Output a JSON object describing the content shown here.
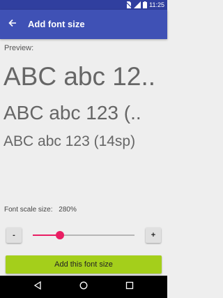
{
  "status_bar": {
    "time": "11:25"
  },
  "app_bar": {
    "title": "Add font size",
    "back_icon": "arrow-back-icon"
  },
  "preview": {
    "label": "Preview:",
    "samples": [
      {
        "text": "ABC abc 12.."
      },
      {
        "text": "ABC abc 123 (.."
      },
      {
        "text": "ABC abc 123 (14sp)"
      }
    ]
  },
  "font_scale": {
    "label": "Font scale size:",
    "value": "280%",
    "slider_fraction": 0.27
  },
  "stepper": {
    "minus_label": "-",
    "plus_label": "+"
  },
  "add_button": {
    "label": "Add this font size"
  },
  "colors": {
    "app_bar": "#3f51b5",
    "status_bar": "#303f9f",
    "accent": "#e91e63",
    "button": "#a4cf1b",
    "background": "#eeeeee"
  }
}
